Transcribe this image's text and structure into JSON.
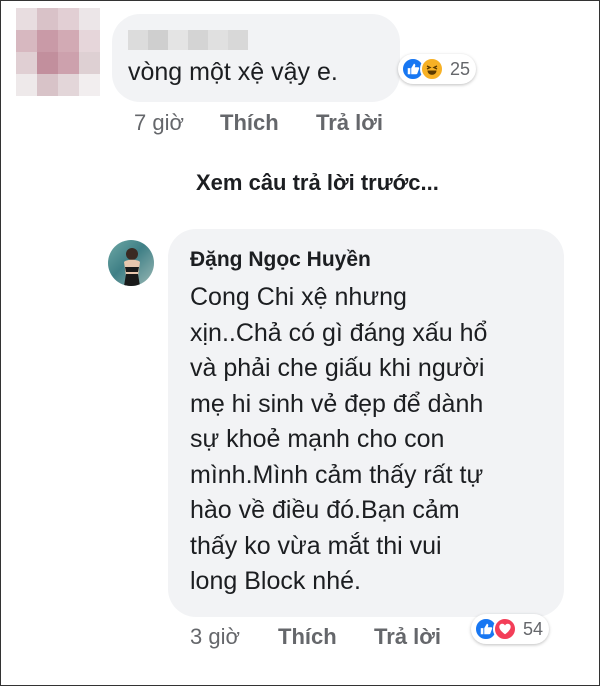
{
  "comment_1": {
    "text": "vòng một xệ vậy e.",
    "reaction_count": "25",
    "reaction_icons": [
      "like-icon",
      "haha-icon"
    ],
    "time": "7 giờ",
    "like_label": "Thích",
    "reply_label": "Trả lời"
  },
  "view_more_replies": "Xem câu trả lời trước...",
  "comment_2": {
    "author": "Đặng Ngọc Huyền",
    "lines": [
      "Cong Chi  xệ nhưng",
      "xịn..Chả có gì đáng xấu hổ",
      "và phải che giấu khi người",
      "mẹ hi sinh vẻ đẹp để dành",
      "sự khoẻ mạnh cho con",
      "mình.Mình cảm thấy rất tự",
      "hào về điều đó.Bạn cảm",
      "thấy ko vừa mắt thi vui",
      "long Block nhé."
    ],
    "reaction_count": "54",
    "reaction_icons": [
      "like-icon",
      "love-icon"
    ],
    "time": "3 giờ",
    "like_label": "Thích",
    "reply_label": "Trả lời"
  },
  "colors": {
    "bubble": "#f2f3f5",
    "meta_text": "#65676b",
    "like_blue": "#1877f2",
    "love_red": "#f33e58",
    "haha_yellow": "#f7b125"
  }
}
